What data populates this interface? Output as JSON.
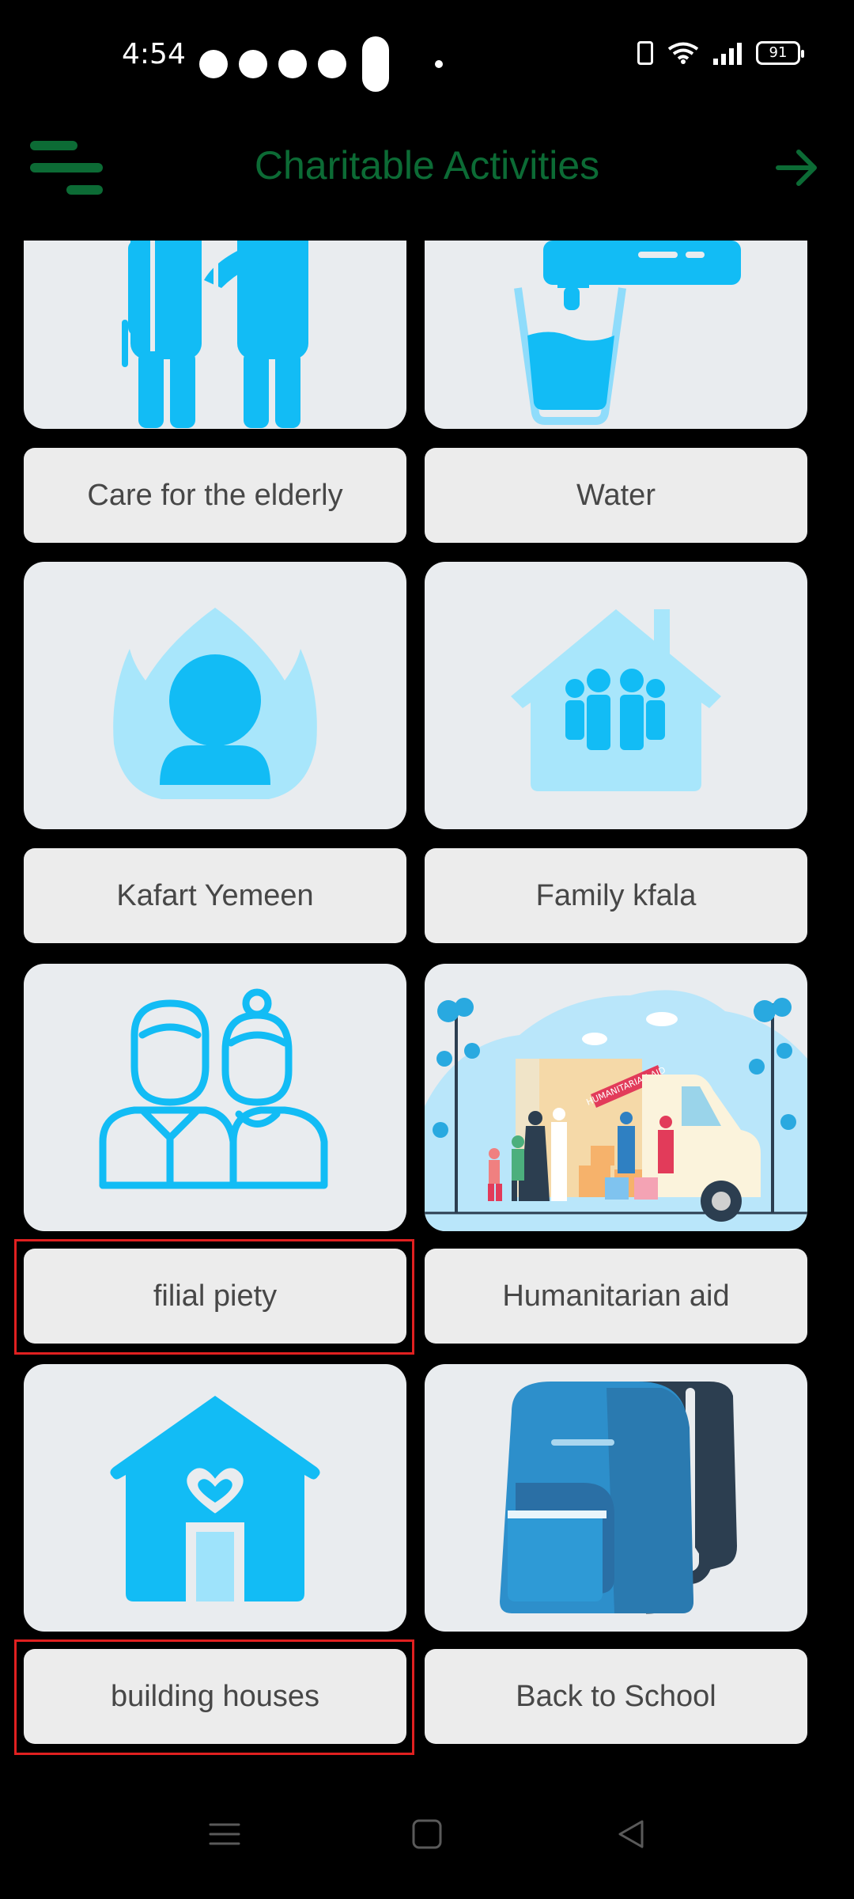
{
  "status_bar": {
    "time": "4:54",
    "battery": "91",
    "notification_icons": [
      "snapchat-icon",
      "messenger-icon",
      "pinterest-icon",
      "whatsapp-icon"
    ]
  },
  "app_bar": {
    "title": "Charitable Activities"
  },
  "colors": {
    "accent": "#0c6b35",
    "icon_blue": "#12bcf5",
    "tile_bg": "#e9ecef",
    "label_bg": "#ececec",
    "highlight": "#e02020"
  },
  "activities": [
    {
      "label": "Care for the elderly",
      "icon": "elderly-care-icon"
    },
    {
      "label": "Water",
      "icon": "water-tap-icon"
    },
    {
      "label": "Kafart Yemeen",
      "icon": "person-flame-icon"
    },
    {
      "label": "Family  kfala",
      "icon": "family-house-icon"
    },
    {
      "label": "filial piety",
      "icon": "elderly-couple-icon"
    },
    {
      "label": "Humanitarian aid",
      "icon": "humanitarian-aid-illustration",
      "truck_text": "HUMANITARIAN AID"
    },
    {
      "label": "building houses",
      "icon": "heart-house-icon"
    },
    {
      "label": "Back to School",
      "icon": "backpack-icon"
    }
  ]
}
